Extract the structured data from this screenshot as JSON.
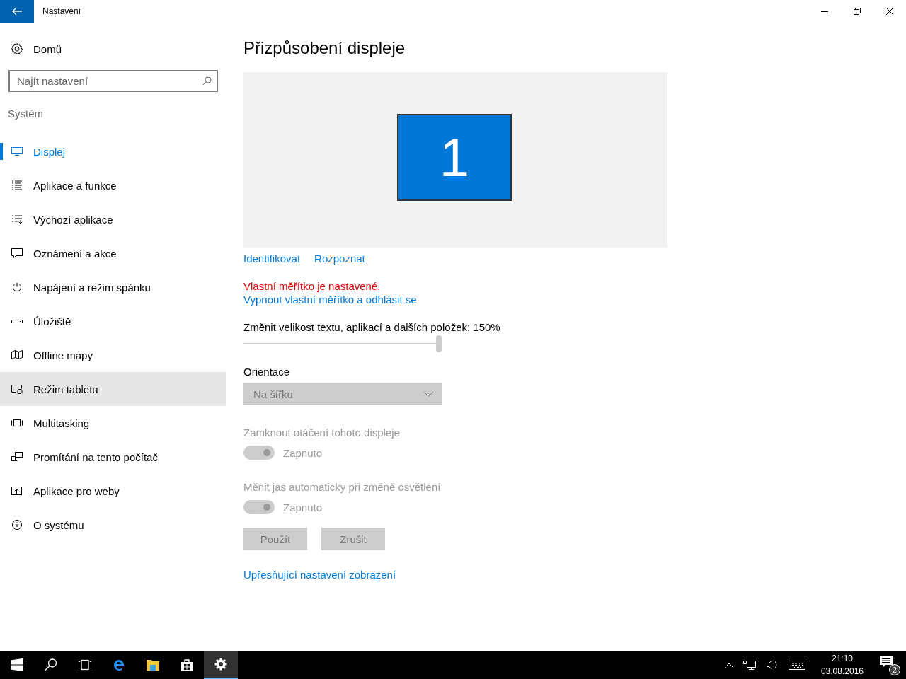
{
  "window": {
    "title": "Nastavení"
  },
  "sidebar": {
    "home": "Domů",
    "search": {
      "placeholder": "Najít nastavení"
    },
    "section": "Systém",
    "items": [
      {
        "label": "Displej",
        "kind": "display",
        "selected": true,
        "hovered": false
      },
      {
        "label": "Aplikace a funkce",
        "kind": "list",
        "selected": false,
        "hovered": false
      },
      {
        "label": "Výchozí aplikace",
        "kind": "defaults",
        "selected": false,
        "hovered": false
      },
      {
        "label": "Oznámení a akce",
        "kind": "notify",
        "selected": false,
        "hovered": false
      },
      {
        "label": "Napájení a režim spánku",
        "kind": "power",
        "selected": false,
        "hovered": false
      },
      {
        "label": "Úložiště",
        "kind": "storage",
        "selected": false,
        "hovered": false
      },
      {
        "label": "Offline mapy",
        "kind": "map",
        "selected": false,
        "hovered": false
      },
      {
        "label": "Režim tabletu",
        "kind": "tablet",
        "selected": false,
        "hovered": true
      },
      {
        "label": "Multitasking",
        "kind": "multitask",
        "selected": false,
        "hovered": false
      },
      {
        "label": "Promítání na tento počítač",
        "kind": "project",
        "selected": false,
        "hovered": false
      },
      {
        "label": "Aplikace pro weby",
        "kind": "web",
        "selected": false,
        "hovered": false
      },
      {
        "label": "O systému",
        "kind": "info",
        "selected": false,
        "hovered": false
      }
    ]
  },
  "main": {
    "title": "Přizpůsobení displeje",
    "monitor": "1",
    "links": [
      "Identifikovat",
      "Rozpoznat"
    ],
    "warning": "Vlastní měřítko je nastavené.",
    "warning_link": "Vypnout vlastní měřítko a odhlásit se",
    "scale": {
      "label": "Změnit velikost textu, aplikací a dalších položek: 150%",
      "level": 1
    },
    "orientation": {
      "label": "Orientace",
      "value": "Na šířku",
      "disabled": true
    },
    "toggles": [
      {
        "label": "Zamknout otáčení tohoto displeje",
        "state": "Zapnuto",
        "on": true,
        "disabled": true
      },
      {
        "label": "Měnit jas automaticky při změně osvětlení",
        "state": "Zapnuto",
        "on": true,
        "disabled": true
      }
    ],
    "buttons": [
      {
        "label": "Použít",
        "disabled": true
      },
      {
        "label": "Zrušit",
        "disabled": true
      }
    ],
    "advanced_link": "Upřesňující nastavení zobrazení"
  },
  "taskbar": {
    "apps": [
      {
        "kind": "start",
        "selected": false
      },
      {
        "kind": "search",
        "selected": false
      },
      {
        "kind": "taskview",
        "selected": false
      },
      {
        "kind": "edge",
        "selected": false
      },
      {
        "kind": "explorer",
        "selected": false
      },
      {
        "kind": "store",
        "selected": false
      },
      {
        "kind": "settings",
        "selected": true
      }
    ],
    "time": "21:10",
    "date": "03.08.2016",
    "notifications": "2"
  }
}
